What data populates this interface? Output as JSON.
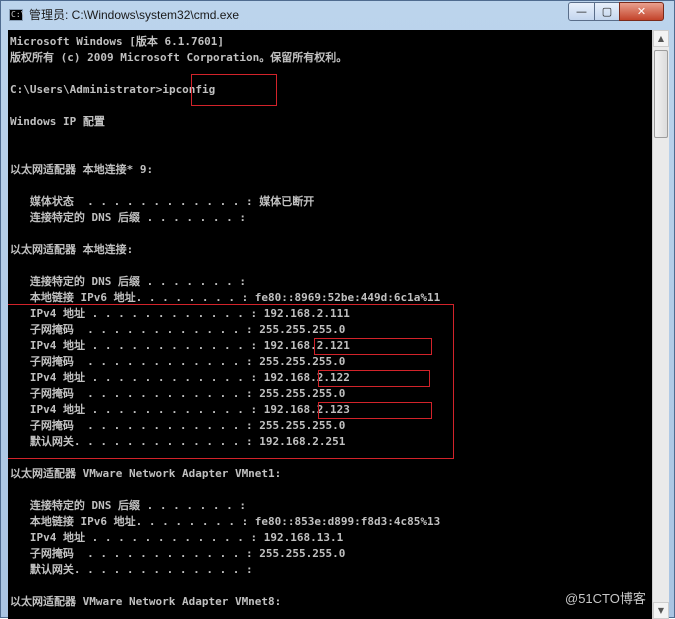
{
  "window": {
    "title": "管理员: C:\\Windows\\system32\\cmd.exe",
    "icon_glyph": "C:\\",
    "minimize_glyph": "—",
    "maximize_glyph": "▢",
    "close_glyph": "✕"
  },
  "console": {
    "lines": [
      "Microsoft Windows [版本 6.1.7601]",
      "版权所有 (c) 2009 Microsoft Corporation。保留所有权利。",
      "",
      "C:\\Users\\Administrator>ipconfig",
      "",
      "Windows IP 配置",
      "",
      "",
      "以太网适配器 本地连接* 9:",
      "",
      "   媒体状态  . . . . . . . . . . . . : 媒体已断开",
      "   连接特定的 DNS 后缀 . . . . . . . :",
      "",
      "以太网适配器 本地连接:",
      "",
      "   连接特定的 DNS 后缀 . . . . . . . :",
      "   本地链接 IPv6 地址. . . . . . . . : fe80::8969:52be:449d:6c1a%11",
      "   IPv4 地址 . . . . . . . . . . . . : 192.168.2.111",
      "   子网掩码  . . . . . . . . . . . . : 255.255.255.0",
      "   IPv4 地址 . . . . . . . . . . . . : 192.168.2.121",
      "   子网掩码  . . . . . . . . . . . . : 255.255.255.0",
      "   IPv4 地址 . . . . . . . . . . . . : 192.168.2.122",
      "   子网掩码  . . . . . . . . . . . . : 255.255.255.0",
      "   IPv4 地址 . . . . . . . . . . . . : 192.168.2.123",
      "   子网掩码  . . . . . . . . . . . . : 255.255.255.0",
      "   默认网关. . . . . . . . . . . . . : 192.168.2.251",
      "",
      "以太网适配器 VMware Network Adapter VMnet1:",
      "",
      "   连接特定的 DNS 后缀 . . . . . . . :",
      "   本地链接 IPv6 地址. . . . . . . . : fe80::853e:d899:f8d3:4c85%13",
      "   IPv4 地址 . . . . . . . . . . . . : 192.168.13.1",
      "   子网掩码  . . . . . . . . . . . . : 255.255.255.0",
      "   默认网关. . . . . . . . . . . . . :",
      "",
      "以太网适配器 VMware Network Adapter VMnet8:"
    ]
  },
  "scrollbar": {
    "up_glyph": "▲",
    "down_glyph": "▼"
  },
  "watermark": "@51CTO博客",
  "colors": {
    "console_bg": "#000000",
    "console_text": "#c0c0c0",
    "highlight_border": "#d2232a"
  }
}
